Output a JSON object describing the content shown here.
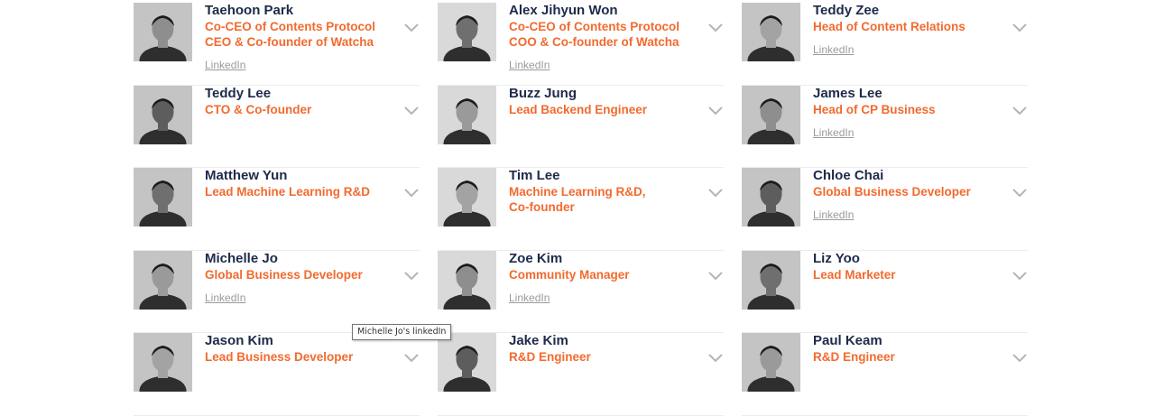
{
  "colors": {
    "name": "#1e2a4a",
    "title": "#f26a2e",
    "link": "#9a9a9a"
  },
  "team": [
    {
      "name": "Taehoon Park",
      "title": [
        "Co-CEO of Contents Protocol",
        "CEO & Co-founder of Watcha"
      ],
      "link": "LinkedIn"
    },
    {
      "name": "Alex Jihyun Won",
      "title": [
        "Co-CEO of Contents Protocol",
        "COO & Co-founder of Watcha"
      ],
      "link": "LinkedIn"
    },
    {
      "name": "Teddy Zee",
      "title": [
        "Head of Content Relations"
      ],
      "link": "LinkedIn"
    },
    {
      "name": "Teddy Lee",
      "title": [
        "CTO & Co-founder"
      ],
      "link": null
    },
    {
      "name": "Buzz Jung",
      "title": [
        "Lead Backend Engineer"
      ],
      "link": null
    },
    {
      "name": "James Lee",
      "title": [
        "Head of CP Business"
      ],
      "link": "LinkedIn"
    },
    {
      "name": "Matthew Yun",
      "title": [
        "Lead Machine Learning R&D"
      ],
      "link": null
    },
    {
      "name": "Tim Lee",
      "title": [
        "Machine Learning R&D,",
        "Co-founder"
      ],
      "link": null
    },
    {
      "name": "Chloe Chai",
      "title": [
        "Global Business Developer"
      ],
      "link": "LinkedIn"
    },
    {
      "name": "Michelle Jo",
      "title": [
        "Global Business Developer"
      ],
      "link": "LinkedIn"
    },
    {
      "name": "Zoe Kim",
      "title": [
        "Community Manager"
      ],
      "link": "LinkedIn"
    },
    {
      "name": "Liz Yoo",
      "title": [
        "Lead Marketer"
      ],
      "link": null
    },
    {
      "name": "Jason Kim",
      "title": [
        "Lead Business Developer"
      ],
      "link": null
    },
    {
      "name": "Jake Kim",
      "title": [
        "R&D Engineer"
      ],
      "link": null
    },
    {
      "name": "Paul Keam",
      "title": [
        "R&D Engineer"
      ],
      "link": null
    }
  ],
  "icons": {
    "expand": "chevron-down-icon",
    "photo": "portrait-photo"
  },
  "tooltip": "Michelle Jo's linkedIn"
}
